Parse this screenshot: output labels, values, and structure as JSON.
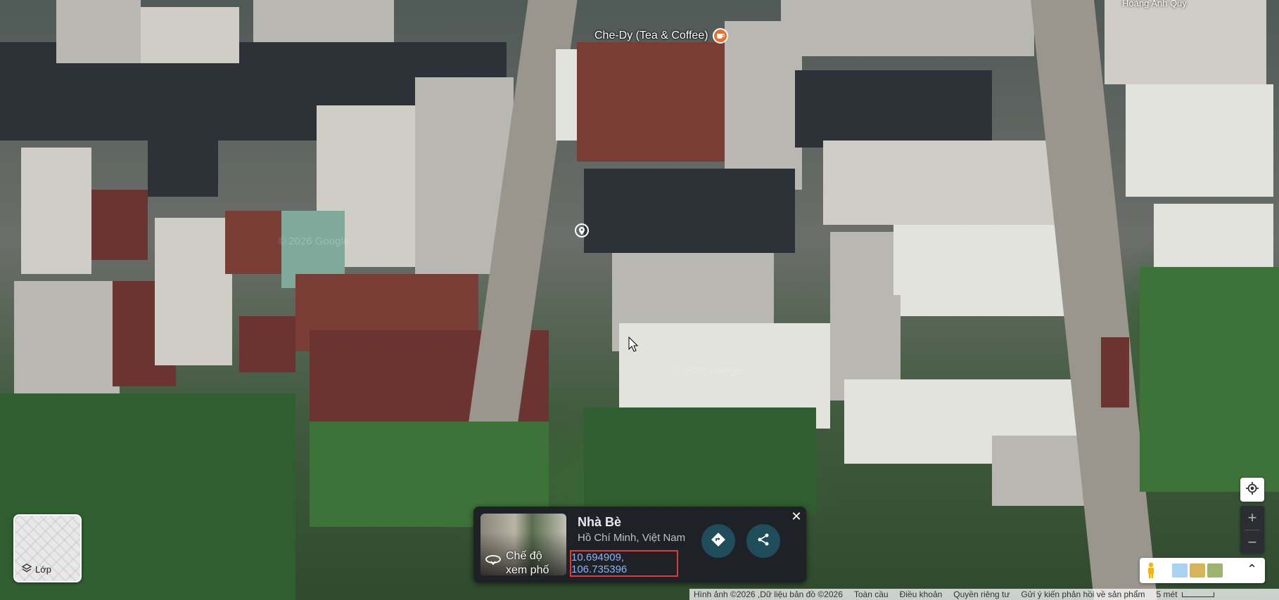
{
  "map": {
    "poi_label": "Che-Dy (Tea & Coffee)",
    "poi_icon": "cafe-icon",
    "watermark": "© 2026 Google",
    "top_right_label": "Hoàng Anh Quy"
  },
  "layers": {
    "label": "Lớp",
    "icon": "layers-icon"
  },
  "place_card": {
    "street_view_label_line1": "Chế độ",
    "street_view_label_line2": "xem phố",
    "name": "Nhà Bè",
    "subtitle": "Hồ Chí Minh, Việt Nam",
    "coordinates": "10.694909, 106.735396",
    "accent_color": "#8ab4f8",
    "highlight_color": "#e53935"
  },
  "controls": {
    "zoom_in": "+",
    "zoom_out": "−",
    "expand": "⌃"
  },
  "footer": {
    "attribution": "Hình ảnh ©2026 ,Dữ liệu bản đồ ©2026",
    "global": "Toàn cầu",
    "terms": "Điều khoản",
    "privacy": "Quyền riêng tư",
    "feedback": "Gửi ý kiến phản hồi về sản phẩm",
    "scale": "5 mét"
  }
}
